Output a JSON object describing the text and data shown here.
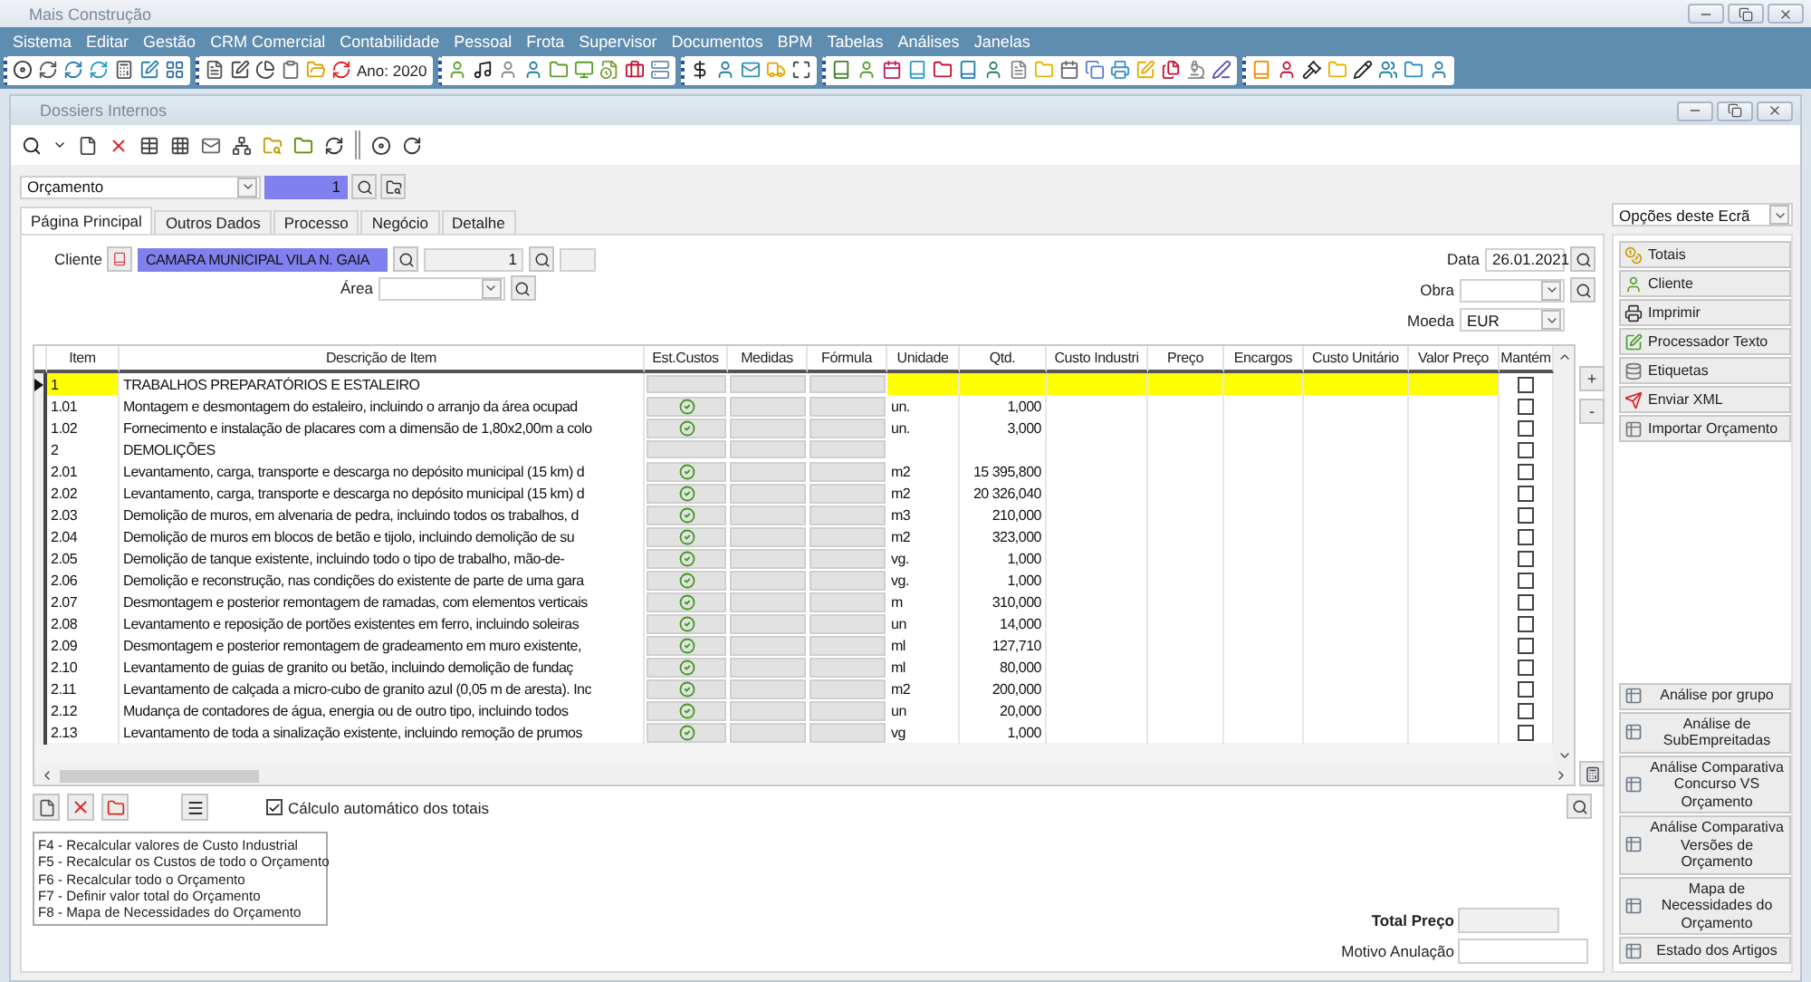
{
  "app": {
    "title": "Mais Construção"
  },
  "menu": [
    {
      "label": "Sistema"
    },
    {
      "label": "Editar"
    },
    {
      "label": "Gestão"
    },
    {
      "label": "CRM Comercial"
    },
    {
      "label": "Contabilidade"
    },
    {
      "label": "Pessoal"
    },
    {
      "label": "Frota"
    },
    {
      "label": "Supervisor"
    },
    {
      "label": "Documentos"
    },
    {
      "label": "BPM"
    },
    {
      "label": "Tabelas"
    },
    {
      "label": "Análises"
    },
    {
      "label": "Janelas"
    }
  ],
  "toolbar": {
    "year_label": "Ano: 2020"
  },
  "document_window": {
    "title": "Dossiers Internos"
  },
  "doc_type": {
    "value": "Orçamento"
  },
  "doc_number": {
    "value": "1"
  },
  "tabs": [
    {
      "label": "Página Principal",
      "selected": true
    },
    {
      "label": "Outros Dados",
      "selected": false
    },
    {
      "label": "Processo",
      "selected": false
    },
    {
      "label": "Negócio",
      "selected": false
    },
    {
      "label": "Detalhe",
      "selected": false
    }
  ],
  "client": {
    "label": "Cliente",
    "name": "CAMARA MUNICIPAL VILA N. GAIA",
    "number": "1"
  },
  "area": {
    "label": "Área"
  },
  "date": {
    "label": "Data",
    "value": "26.01.2021"
  },
  "obra": {
    "label": "Obra"
  },
  "currency": {
    "label": "Moeda",
    "value": "EUR"
  },
  "grid": {
    "columns": [
      "Item",
      "Descrição de Item",
      "Est.Custos",
      "Medidas",
      "Fórmula",
      "Unidade",
      "Qtd.",
      "Custo Industri",
      "Preço",
      "Encargos",
      "Custo Unitário",
      "Valor Preço",
      "Mantém"
    ],
    "rows": [
      {
        "item": "1",
        "description": "TRABALHOS PREPARATÓRIOS E ESTALEIRO",
        "cost_ok": false,
        "unit": "",
        "qty": "",
        "keep": false,
        "selected": true
      },
      {
        "item": "1.01",
        "description": "Montagem e desmontagem do estaleiro, incluindo o arranjo da área ocupad",
        "cost_ok": true,
        "unit": "un.",
        "qty": "1,000",
        "keep": false,
        "selected": false
      },
      {
        "item": "1.02",
        "description": "Fornecimento e instalação de placares com a dimensão de 1,80x2,00m a colo",
        "cost_ok": true,
        "unit": "un.",
        "qty": "3,000",
        "keep": false,
        "selected": false
      },
      {
        "item": "2",
        "description": "DEMOLIÇÕES",
        "cost_ok": false,
        "unit": "",
        "qty": "",
        "keep": false,
        "selected": false
      },
      {
        "item": "2.01",
        "description": "Levantamento, carga, transporte e descarga no depósito municipal (15 km) d",
        "cost_ok": true,
        "unit": "m2",
        "qty": "15 395,800",
        "keep": false,
        "selected": false
      },
      {
        "item": "2.02",
        "description": "Levantamento, carga, transporte e descarga no depósito municipal (15 km) d",
        "cost_ok": true,
        "unit": "m2",
        "qty": "20 326,040",
        "keep": false,
        "selected": false
      },
      {
        "item": "2.03",
        "description": "Demolição de muros, em alvenaria de pedra, incluindo todos os trabalhos, d",
        "cost_ok": true,
        "unit": "m3",
        "qty": "210,000",
        "keep": false,
        "selected": false
      },
      {
        "item": "2.04",
        "description": "Demolição de muros em blocos de betão e tijolo, incluindo demolição de su",
        "cost_ok": true,
        "unit": "m2",
        "qty": "323,000",
        "keep": false,
        "selected": false
      },
      {
        "item": "2.05",
        "description": "Demolição de tanque existente, incluindo todo o tipo de trabalho, mão-de-",
        "cost_ok": true,
        "unit": "vg.",
        "qty": "1,000",
        "keep": false,
        "selected": false
      },
      {
        "item": "2.06",
        "description": "Demolição e reconstrução, nas condições do existente de parte de uma gara",
        "cost_ok": true,
        "unit": "vg.",
        "qty": "1,000",
        "keep": false,
        "selected": false
      },
      {
        "item": "2.07",
        "description": "Desmontagem e posterior remontagem de ramadas, com elementos verticais",
        "cost_ok": true,
        "unit": "m",
        "qty": "310,000",
        "keep": false,
        "selected": false
      },
      {
        "item": "2.08",
        "description": "Levantamento e reposição de portões existentes em ferro, incluindo soleiras",
        "cost_ok": true,
        "unit": "un",
        "qty": "14,000",
        "keep": false,
        "selected": false
      },
      {
        "item": "2.09",
        "description": "Desmontagem e posterior remontagem de gradeamento em muro existente,",
        "cost_ok": true,
        "unit": "ml",
        "qty": "127,710",
        "keep": false,
        "selected": false
      },
      {
        "item": "2.10",
        "description": "Levantamento de guias de granito ou betão, incluindo demolição de fundaç",
        "cost_ok": true,
        "unit": "ml",
        "qty": "80,000",
        "keep": false,
        "selected": false
      },
      {
        "item": "2.11",
        "description": "Levantamento de calçada a micro-cubo de granito azul (0,05 m de aresta). Inc",
        "cost_ok": true,
        "unit": "m2",
        "qty": "200,000",
        "keep": false,
        "selected": false
      },
      {
        "item": "2.12",
        "description": "Mudança de contadores de água, energia ou de outro tipo, incluindo todos",
        "cost_ok": true,
        "unit": "un",
        "qty": "20,000",
        "keep": false,
        "selected": false
      },
      {
        "item": "2.13",
        "description": "Levantamento de toda a sinalização existente, incluindo remoção de prumos",
        "cost_ok": true,
        "unit": "vg",
        "qty": "1,000",
        "keep": false,
        "selected": false
      }
    ]
  },
  "row_buttons": {
    "add": "+",
    "remove": "-"
  },
  "auto_totals": {
    "label": "Cálculo automático dos totais",
    "checked": true
  },
  "shortcuts": [
    "F4 - Recalcular valores de Custo Industrial",
    "F5 - Recalcular os Custos de todo o Orçamento",
    "F6 - Recalcular todo o Orçamento",
    "F7 - Definir valor total do Orçamento",
    "F8 - Mapa de Necessidades do Orçamento"
  ],
  "totals": {
    "total_label": "Total Preço",
    "cancel_label": "Motivo Anulação"
  },
  "options": {
    "value": "Opções deste Ecrã"
  },
  "actions": [
    "Totais",
    "Cliente",
    "Imprimir",
    "Processador Texto",
    "Etiquetas",
    "Enviar XML",
    "Importar Orçamento"
  ],
  "analyses": [
    "Análise por grupo",
    "Análise de SubEmpreitadas",
    "Análise Comparativa Concurso VS Orçamento",
    "Análise Comparativa Versões de Orçamento",
    "Mapa de Necessidades do Orçamento",
    "Estado dos Artigos"
  ]
}
